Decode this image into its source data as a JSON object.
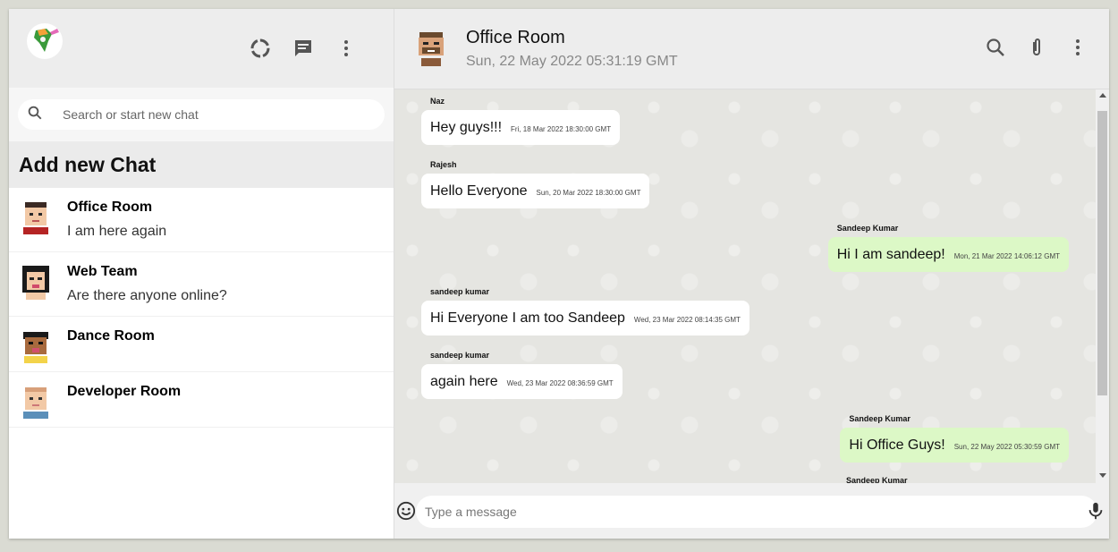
{
  "sidebar": {
    "search_placeholder": "Search or start new chat",
    "add_new_chat": "Add new Chat",
    "chats": [
      {
        "name": "Office Room",
        "last": "I am here again"
      },
      {
        "name": "Web Team",
        "last": "Are there anyone online?"
      },
      {
        "name": "Dance Room",
        "last": ""
      },
      {
        "name": "Developer Room",
        "last": ""
      }
    ]
  },
  "chat_header": {
    "title": "Office Room",
    "subtitle": "Sun, 22 May 2022 05:31:19 GMT"
  },
  "messages": [
    {
      "sender": "Naz",
      "text": "Hey guys!!!",
      "time": "Fri, 18 Mar 2022 18:30:00 GMT",
      "mine": false
    },
    {
      "sender": "Rajesh",
      "text": "Hello Everyone",
      "time": "Sun, 20 Mar 2022 18:30:00 GMT",
      "mine": false
    },
    {
      "sender": "Sandeep Kumar",
      "text": "Hi I am sandeep!",
      "time": "Mon, 21 Mar 2022 14:06:12 GMT",
      "mine": true
    },
    {
      "sender": "sandeep kumar",
      "text": "Hi Everyone I am too Sandeep",
      "time": "Wed, 23 Mar 2022 08:14:35 GMT",
      "mine": false
    },
    {
      "sender": "sandeep kumar",
      "text": "again here",
      "time": "Wed, 23 Mar 2022 08:36:59 GMT",
      "mine": false
    },
    {
      "sender": "Sandeep Kumar",
      "text": "Hi Office Guys!",
      "time": "Sun, 22 May 2022 05:30:59 GMT",
      "mine": true
    },
    {
      "sender": "Sandeep Kumar",
      "text": "",
      "time": "",
      "mine": true
    }
  ],
  "footer": {
    "placeholder": "Type a message"
  },
  "colors": {
    "header_bg": "#ededed",
    "my_bubble": "#dcf8c6",
    "chat_bg": "#e5e5e1"
  },
  "icons": [
    "status-icon",
    "new-chat-icon",
    "menu-icon",
    "search-icon",
    "attach-icon",
    "emoji-icon",
    "mic-icon"
  ]
}
